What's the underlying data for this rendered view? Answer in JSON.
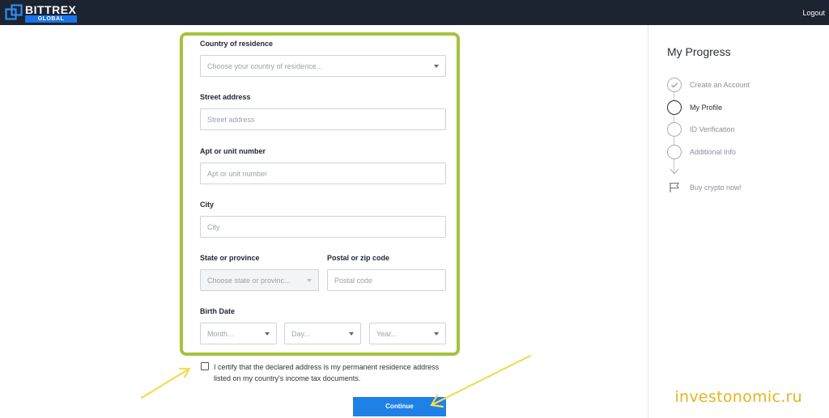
{
  "header": {
    "brand": "BITTREX",
    "brand_sub": "GLOBAL",
    "logout_label": "Logout"
  },
  "form": {
    "country": {
      "label": "Country of residence",
      "placeholder": "Choose your country of residence..."
    },
    "street": {
      "label": "Street address",
      "placeholder": "Street address"
    },
    "apt": {
      "label": "Apt or unit number",
      "placeholder": "Apt or unit number"
    },
    "city": {
      "label": "City",
      "placeholder": "City"
    },
    "state": {
      "label": "State or province",
      "placeholder": "Choose state or provinc..."
    },
    "postal": {
      "label": "Postal or zip code",
      "placeholder": "Postal code"
    },
    "birth": {
      "label": "Birth Date",
      "month_placeholder": "Month...",
      "day_placeholder": "Day...",
      "year_placeholder": "Year..."
    },
    "certify_text": "I certify that the declared address is my permanent residence address listed on my country's income tax documents.",
    "continue_label": "Continue"
  },
  "progress": {
    "title": "My Progress",
    "steps": [
      {
        "label": "Create an Account",
        "state": "done"
      },
      {
        "label": "My Profile",
        "state": "current"
      },
      {
        "label": "ID Verification",
        "state": "pending"
      },
      {
        "label": "Additional Info",
        "state": "pending"
      }
    ],
    "final_step": "Buy crypto now!"
  },
  "watermark": "investonomic.ru",
  "colors": {
    "header_bg": "#1c2331",
    "highlight_frame": "#a4c23c",
    "annotation_arrow": "#f2dc5a",
    "button": "#1f80e6"
  }
}
